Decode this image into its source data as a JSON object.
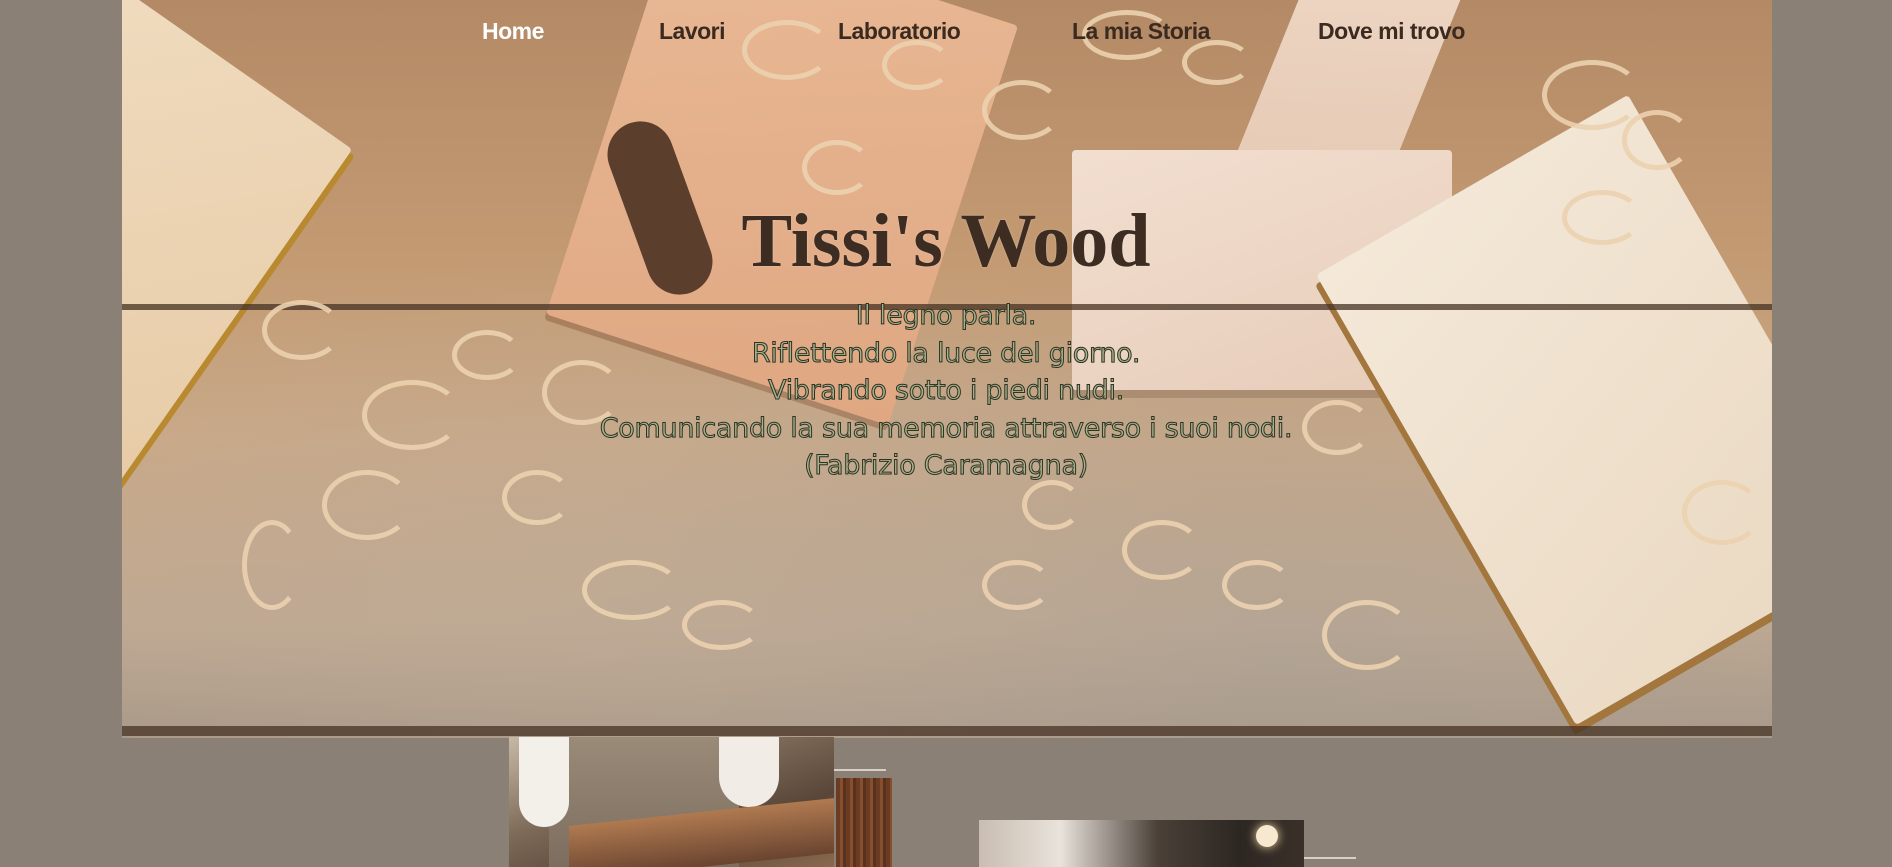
{
  "nav": {
    "items": [
      {
        "label": "Home",
        "active": true
      },
      {
        "label": "Lavori",
        "active": false
      },
      {
        "label": "Laboratorio",
        "active": false
      },
      {
        "label": "La mia Storia",
        "active": false
      },
      {
        "label": "Dove mi trovo",
        "active": false
      }
    ]
  },
  "hero": {
    "title": "Tissi's Wood",
    "poem": [
      "Il legno parla.",
      "Riflettendo la luce del giorno.",
      "Vibrando sotto i piedi nudi.",
      "Comunicando la sua memoria attraverso i suoi nodi.",
      "(Fabrizio Caramagna)"
    ]
  },
  "colors": {
    "page_background": "#8b8075",
    "nav_text": "#3a2a20",
    "nav_active_text": "#ffffff",
    "title_text": "#3d2c21",
    "poem_fill": "#a7b08a",
    "poem_outline": "#2f3324"
  }
}
